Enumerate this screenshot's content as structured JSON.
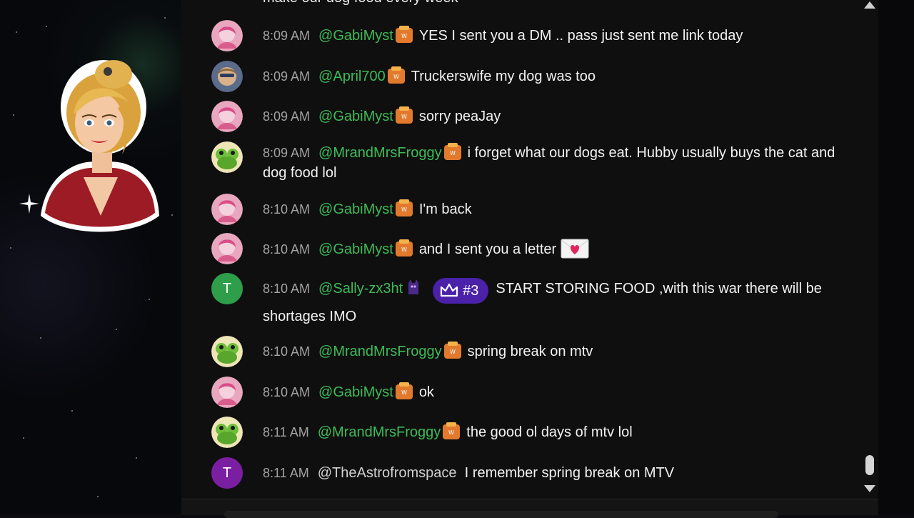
{
  "messages": [
    {
      "author": "",
      "time": "",
      "text": "make our dog food every week",
      "avatar": "none",
      "badge": "none"
    },
    {
      "time": "8:09 AM",
      "author": "@GabiMyst",
      "text": "YES I sent you a DM .. pass just sent me link today",
      "avatar": "gabi",
      "badge": "wat"
    },
    {
      "time": "8:09 AM",
      "author": "@April700",
      "text": "Truckerswife my dog was too",
      "avatar": "april",
      "badge": "wat"
    },
    {
      "time": "8:09 AM",
      "author": "@GabiMyst",
      "text": "sorry peaJay",
      "avatar": "gabi",
      "badge": "wat"
    },
    {
      "time": "8:09 AM",
      "author": "@MrandMrsFroggy",
      "text": "i forget what our dogs eat. Hubby usually buys the cat and dog food lol",
      "avatar": "froggy",
      "badge": "wat"
    },
    {
      "time": "8:10 AM",
      "author": "@GabiMyst",
      "text": "I'm back",
      "avatar": "gabi",
      "badge": "wat"
    },
    {
      "time": "8:10 AM",
      "author": "@GabiMyst",
      "text": "and I sent you a letter",
      "avatar": "gabi",
      "badge": "wat",
      "emoji": "love-letter"
    },
    {
      "time": "8:10 AM",
      "author": "@Sally-zx3ht",
      "text": "START STORING FOOD ,with this war there will be shortages IMO",
      "avatar": "T",
      "avatar_color": "#2e9e4a",
      "badge": "cat",
      "rank": "#3"
    },
    {
      "time": "8:10 AM",
      "author": "@MrandMrsFroggy",
      "text": "spring break on mtv",
      "avatar": "froggy",
      "badge": "wat"
    },
    {
      "time": "8:10 AM",
      "author": "@GabiMyst",
      "text": "ok",
      "avatar": "gabi",
      "badge": "wat"
    },
    {
      "time": "8:11 AM",
      "author": "@MrandMrsFroggy",
      "text": "the good ol days of mtv lol",
      "avatar": "froggy",
      "badge": "wat"
    },
    {
      "time": "8:11 AM",
      "author": "@TheAstrofromspace",
      "text": "I remember spring break on MTV",
      "avatar": "T",
      "avatar_color": "#7b1fa2",
      "badge": "none"
    }
  ],
  "colors": {
    "author_green": "#3dbb57",
    "rank_purple": "#4a21a8",
    "chat_bg": "#0f0f0f"
  },
  "icons": [
    "sparkle-icon",
    "wat-badge-icon",
    "cat-badge-icon",
    "crown-icon",
    "love-letter-icon",
    "scroll-up-icon",
    "scroll-down-icon"
  ]
}
